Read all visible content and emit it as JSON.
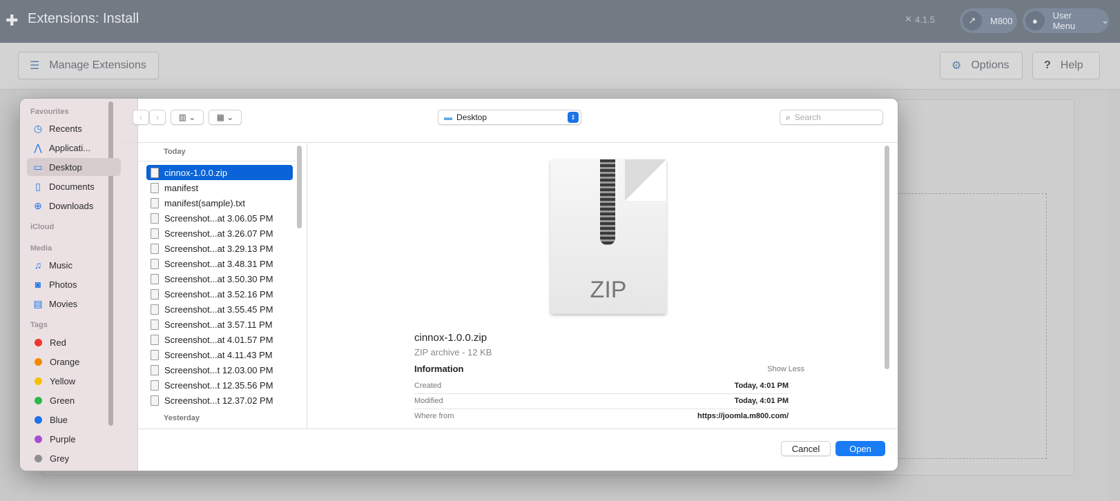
{
  "header": {
    "title": "Extensions: Install",
    "version": "4.1.5",
    "site_label": "M800",
    "user_menu": "User Menu"
  },
  "toolbar": {
    "manage": "Manage Extensions",
    "options": "Options",
    "help": "Help"
  },
  "dialog": {
    "sidebar": {
      "favourites_heading": "Favourites",
      "favourites": [
        {
          "label": "Recents",
          "icon": "clock-icon"
        },
        {
          "label": "Applicati...",
          "icon": "apps-icon"
        },
        {
          "label": "Desktop",
          "icon": "desktop-icon",
          "selected": true
        },
        {
          "label": "Documents",
          "icon": "document-icon"
        },
        {
          "label": "Downloads",
          "icon": "download-icon"
        }
      ],
      "icloud_heading": "iCloud",
      "media_heading": "Media",
      "media": [
        {
          "label": "Music",
          "icon": "music-icon"
        },
        {
          "label": "Photos",
          "icon": "camera-icon"
        },
        {
          "label": "Movies",
          "icon": "film-icon"
        }
      ],
      "tags_heading": "Tags",
      "tags": [
        {
          "label": "Red",
          "color": "#f0352c"
        },
        {
          "label": "Orange",
          "color": "#f08a00"
        },
        {
          "label": "Yellow",
          "color": "#f2c200"
        },
        {
          "label": "Green",
          "color": "#2db84a"
        },
        {
          "label": "Blue",
          "color": "#1a73e8"
        },
        {
          "label": "Purple",
          "color": "#a64fd0"
        },
        {
          "label": "Grey",
          "color": "#8e8e93"
        }
      ]
    },
    "location": "Desktop",
    "search_placeholder": "Search",
    "list": {
      "today_heading": "Today",
      "files": [
        "cinnox-1.0.0.zip",
        "manifest",
        "manifest(sample).txt",
        "Screenshot...at 3.06.05 PM",
        "Screenshot...at 3.26.07 PM",
        "Screenshot...at 3.29.13 PM",
        "Screenshot...at 3.48.31 PM",
        "Screenshot...at 3.50.30 PM",
        "Screenshot...at 3.52.16 PM",
        "Screenshot...at 3.55.45 PM",
        "Screenshot...at 3.57.11 PM",
        "Screenshot...at 4.01.57 PM",
        "Screenshot...at 4.11.43 PM",
        "Screenshot...t 12.03.00 PM",
        "Screenshot...t 12.35.56 PM",
        "Screenshot...t 12.37.02 PM"
      ],
      "yesterday_heading": "Yesterday"
    },
    "preview": {
      "icon_label": "ZIP",
      "name": "cinnox-1.0.0.zip",
      "kind": "ZIP archive - 12 KB",
      "info_heading": "Information",
      "show_less": "Show Less",
      "rows": [
        {
          "label": "Created",
          "value": "Today, 4:01 PM"
        },
        {
          "label": "Modified",
          "value": "Today, 4:01 PM"
        },
        {
          "label": "Where from",
          "value": "https://joomla.m800.com/"
        }
      ]
    },
    "cancel": "Cancel",
    "open": "Open"
  }
}
